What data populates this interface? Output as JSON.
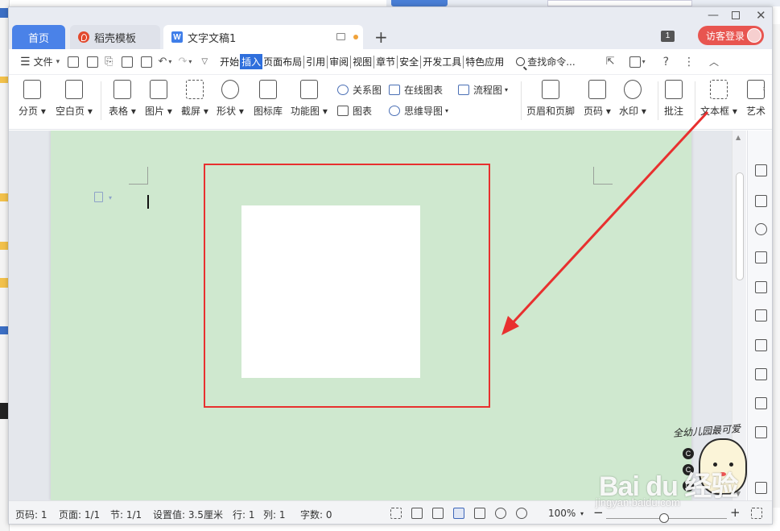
{
  "tabs": {
    "home": "首页",
    "template": "稻壳模板",
    "document": "文字文稿1",
    "doc_badge": "W"
  },
  "titlebar": {
    "counter": "1",
    "login": "访客登录"
  },
  "menu": {
    "file": "文件",
    "tabs": [
      "开始",
      "插入",
      "页面布局",
      "引用",
      "审阅",
      "视图",
      "章节",
      "安全",
      "开发工具",
      "特色应用"
    ],
    "active_tab": "插入",
    "search": "查找命令..."
  },
  "ribbon": {
    "page_break": "分页",
    "blank_page": "空白页",
    "table": "表格",
    "picture": "图片",
    "screenshot": "截屏",
    "shape": "形状",
    "icon_lib": "图标库",
    "function_chart": "功能图",
    "relation_chart": "关系图",
    "online_chart": "在线图表",
    "flowchart": "流程图",
    "chart": "图表",
    "mindmap": "思维导图",
    "header_footer": "页眉和页脚",
    "page_number": "页码",
    "watermark": "水印",
    "comment": "批注",
    "textbox": "文本框",
    "art": "艺术"
  },
  "statusbar": {
    "page_num": "页码: 1",
    "pages": "页面: 1/1",
    "section": "节: 1/1",
    "setting": "设置值: 3.5厘米",
    "row": "行: 1",
    "col": "列: 1",
    "word_count": "字数: 0",
    "zoom": "100%",
    "zoom_minus": "−",
    "zoom_plus": "+"
  },
  "watermark": {
    "brand": "Bai du 经验",
    "url": "jingyan.baidu.com",
    "tagline": "全幼儿园最可爱"
  },
  "colors": {
    "accent": "#4a82e8",
    "page_bg": "#cfe8cf",
    "highlight_box": "#e8302f",
    "login": "#e85550"
  }
}
